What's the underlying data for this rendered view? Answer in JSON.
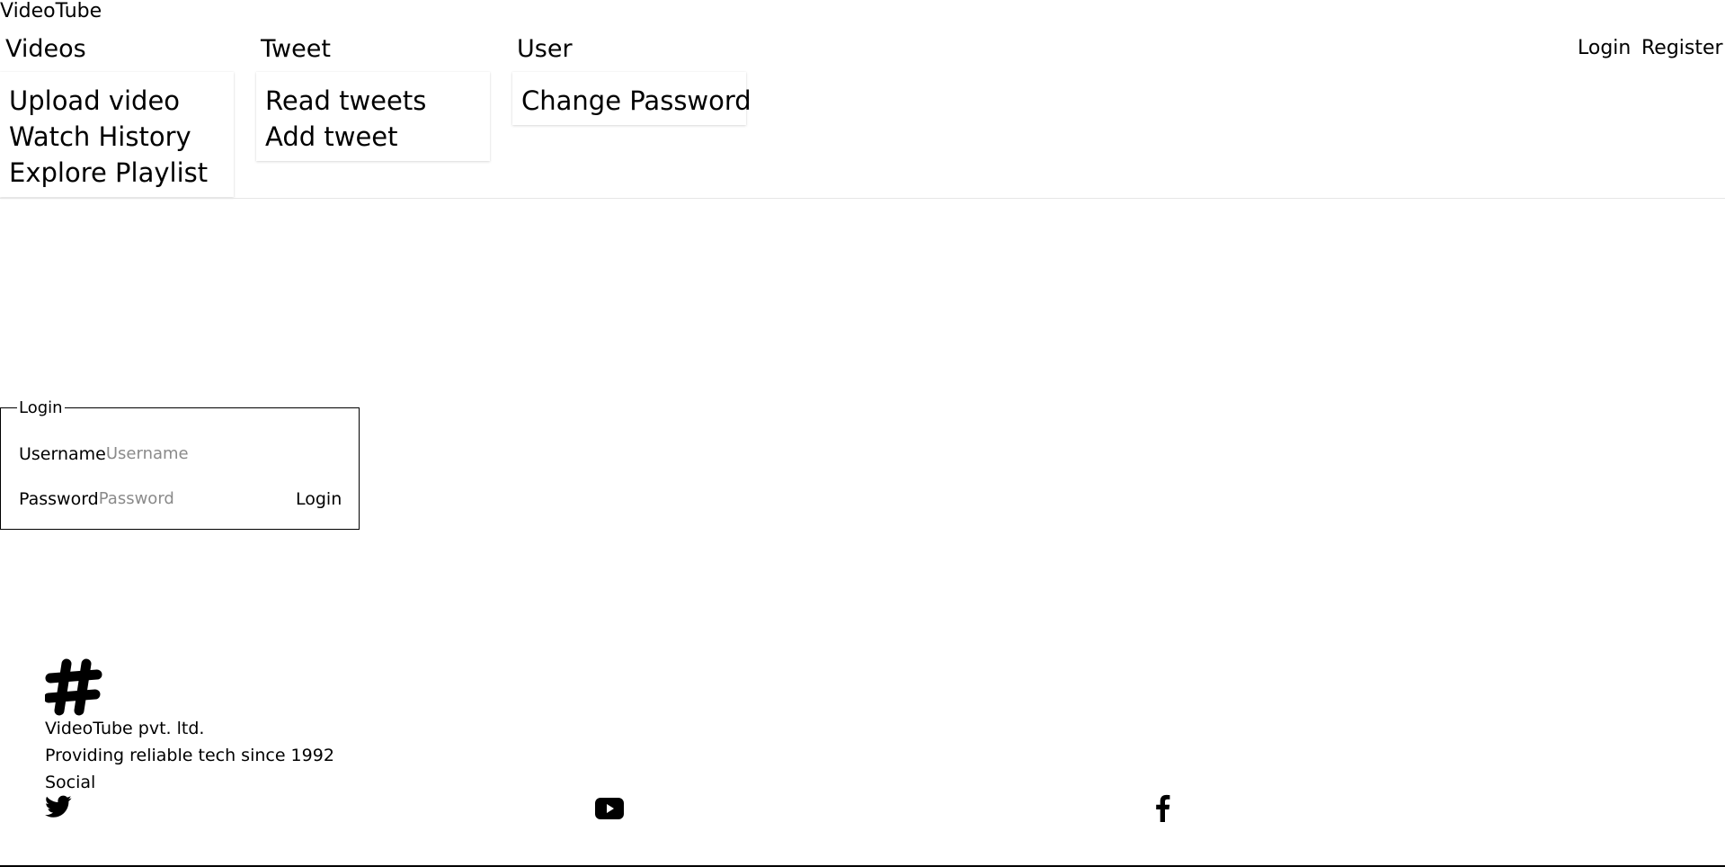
{
  "header": {
    "brand": "VideoTube",
    "menus": [
      {
        "title": "Videos",
        "items": [
          "Upload video",
          "Watch History",
          "Explore Playlist"
        ]
      },
      {
        "title": "Tweet",
        "items": [
          "Read tweets",
          "Add tweet"
        ]
      },
      {
        "title": "User",
        "items": [
          "Change Password"
        ]
      }
    ],
    "auth": {
      "login": "Login",
      "register": "Register"
    }
  },
  "login_form": {
    "legend": "Login",
    "username_label": "Username",
    "username_placeholder": "Username",
    "username_value": "",
    "password_label": "Password",
    "password_placeholder": "Password",
    "password_value": "",
    "submit_label": "Login"
  },
  "footer": {
    "logo_icon": "hashtag-icon",
    "company": "VideoTube pvt. ltd.",
    "tagline": "Providing reliable tech since 1992",
    "social_heading": "Social",
    "social_icons": [
      "twitter-icon",
      "youtube-icon",
      "facebook-icon"
    ]
  }
}
